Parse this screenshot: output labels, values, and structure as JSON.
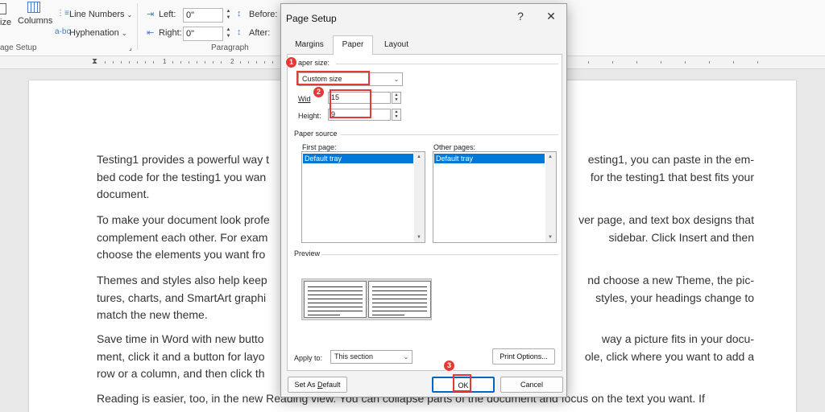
{
  "ribbon": {
    "page_setup_partial": "ize",
    "columns": "Columns",
    "line_numbers": "Line Numbers",
    "hyphenation": "Hyphenation",
    "group_page_setup": "age Setup",
    "left_label": "Left:",
    "right_label": "Right:",
    "indent_left": "0\"",
    "indent_right": "0\"",
    "before_label": "Before:",
    "after_label": "After:",
    "group_paragraph": "Paragraph"
  },
  "ruler": {
    "numbers": [
      "1",
      "2"
    ]
  },
  "document": {
    "paragraphs": [
      [
        "Testing1 provides a powerful way t",
        "esting1, you can paste in the em-"
      ],
      [
        "bed code for the testing1 you wan",
        "for the testing1 that best fits your"
      ],
      [
        "document."
      ],
      [
        "To make your document look profe",
        "ver page, and text box designs that"
      ],
      [
        "complement each other. For exam",
        "sidebar. Click Insert and then"
      ],
      [
        "choose the elements you want fro"
      ],
      [
        "Themes and styles also help keep",
        "nd choose a new Theme, the pic-"
      ],
      [
        "tures, charts, and SmartArt graphi",
        "styles, your headings change to"
      ],
      [
        "match the new theme."
      ],
      [
        "Save time in Word with new butto",
        "way a picture fits in your docu-"
      ],
      [
        "ment, click it and a button for layo",
        "ole, click where you want to add a"
      ],
      [
        "row or a column, and then click th"
      ],
      [
        "Reading is easier, too, in the new Reading view. You can collapse parts of the document and focus on the text you want. If"
      ]
    ]
  },
  "dialog": {
    "title": "Page Setup",
    "help": "?",
    "close": "✕",
    "tabs": [
      "Margins",
      "Paper",
      "Layout"
    ],
    "active_tab": "Paper",
    "paper_size_label": "aper size:",
    "paper_size_value": "Custom size",
    "width_label": "Wid",
    "width_value": "15",
    "height_label": "Height:",
    "height_value": "9",
    "paper_source_label": "Paper source",
    "first_page_label": "First page:",
    "first_page_selected": "Default tray",
    "other_pages_label": "Other pages:",
    "other_pages_selected": "Default tray",
    "preview_label": "Preview",
    "apply_to_label": "Apply to:",
    "apply_to_value": "This section",
    "print_options": "Print Options...",
    "set_as_default": "Set As Default",
    "ok": "OK",
    "cancel": "Cancel"
  },
  "annotations": {
    "markers": [
      "1",
      "2",
      "3"
    ],
    "color": "#e53935"
  },
  "colors": {
    "selection": "#0078d7",
    "accent": "#e53935"
  }
}
